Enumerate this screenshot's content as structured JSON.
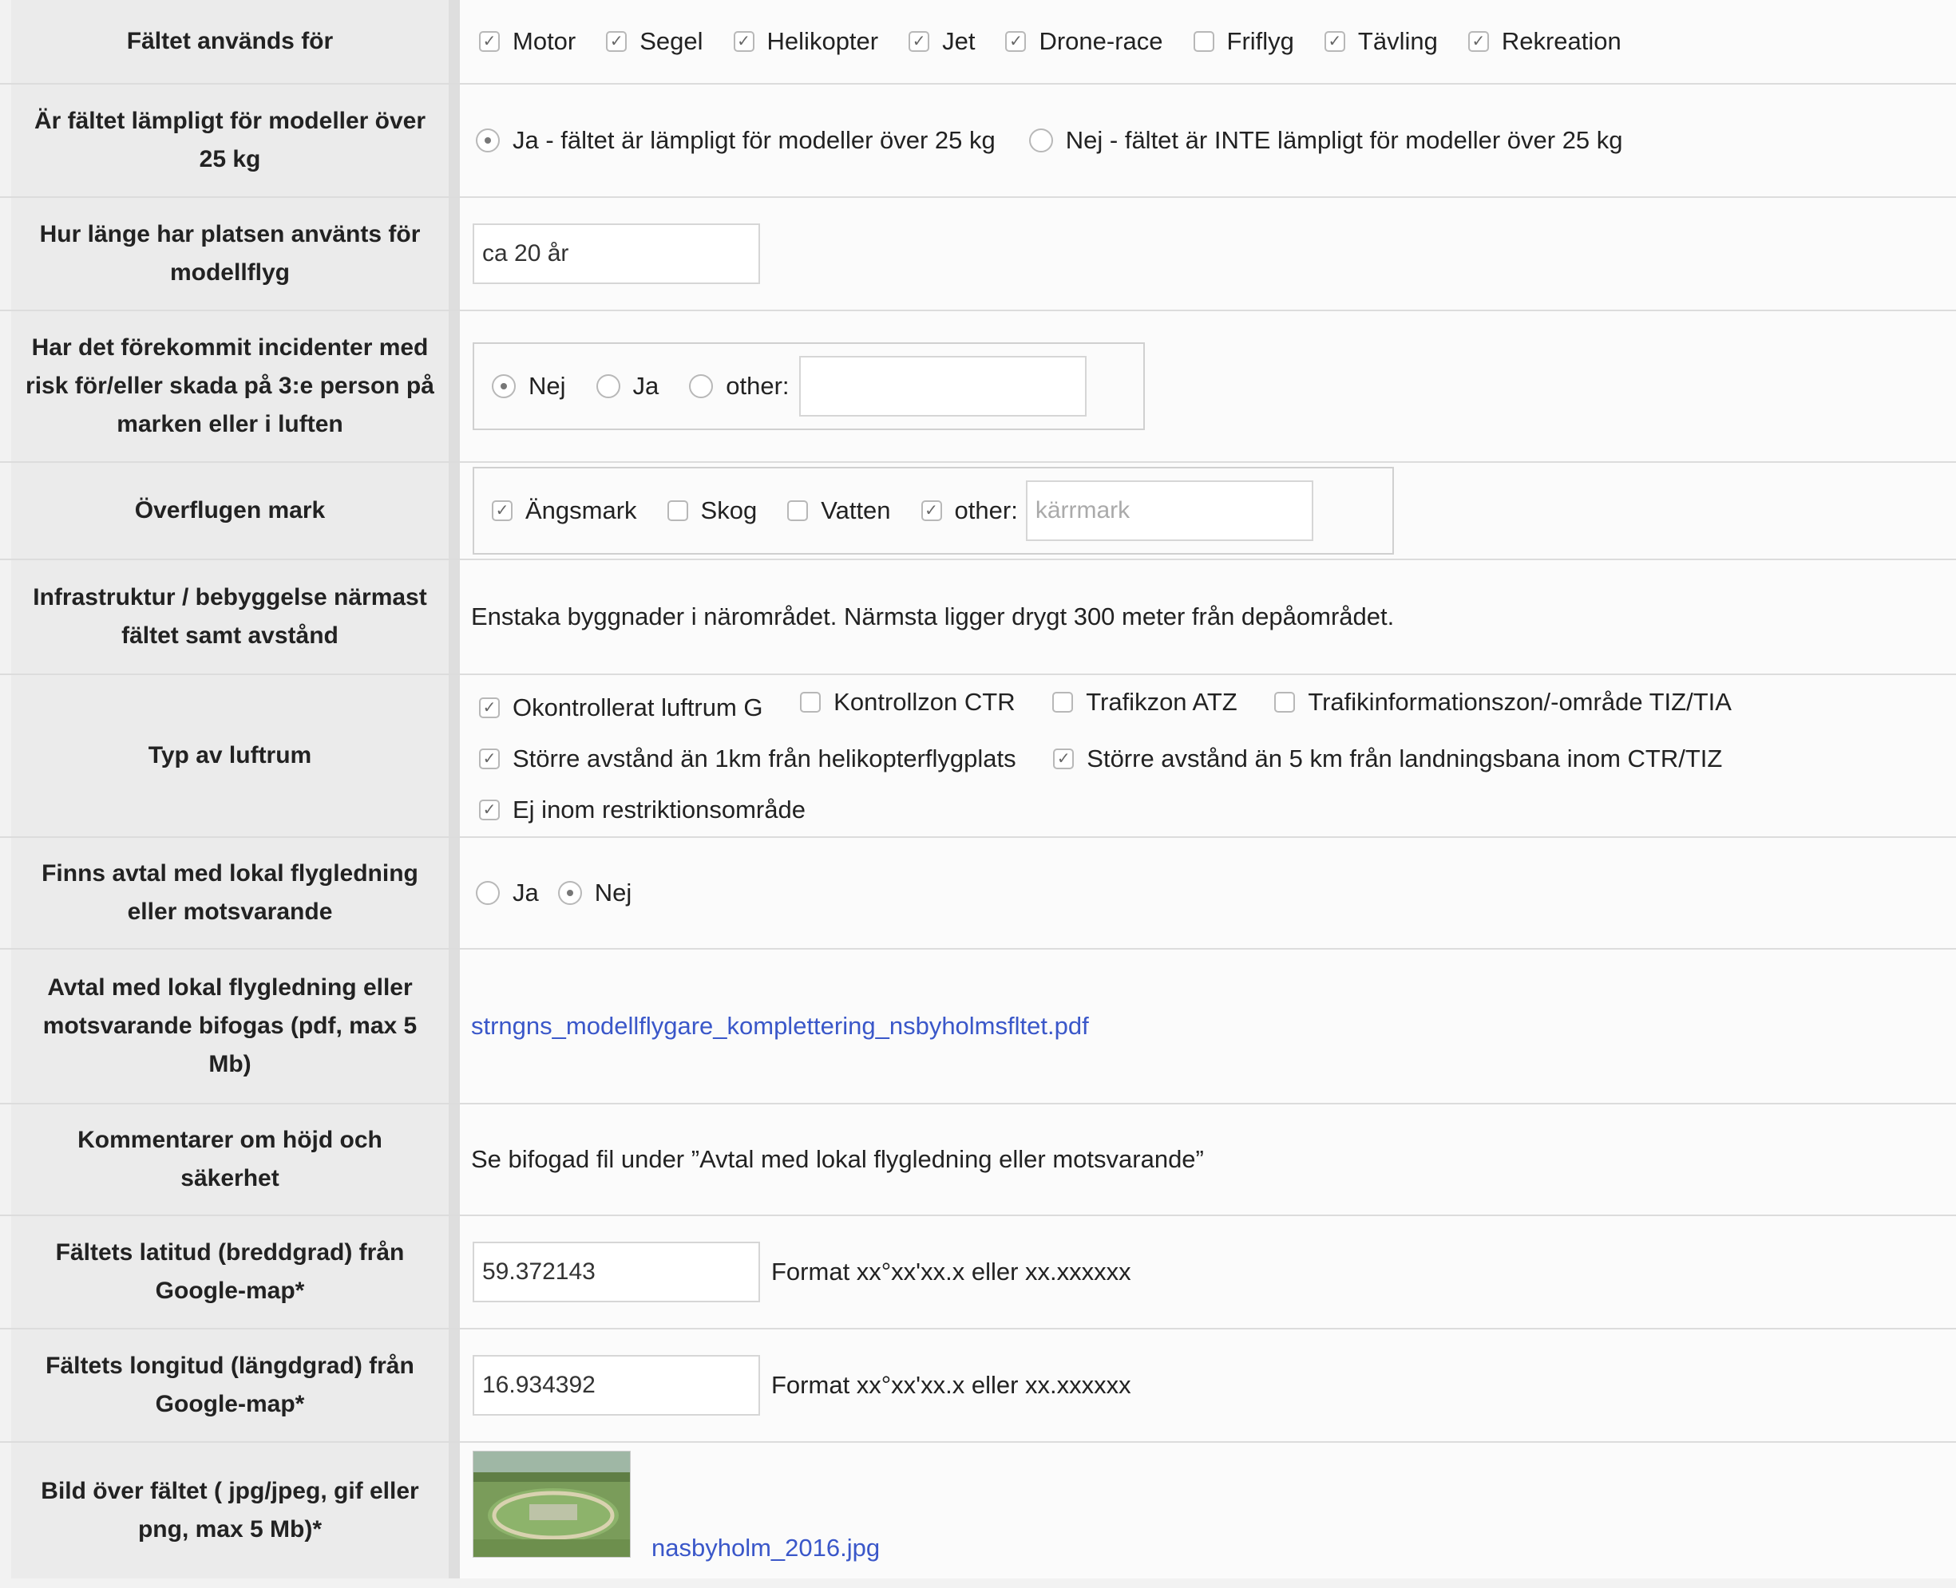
{
  "rows": {
    "usage": {
      "label": "Fältet används för",
      "options": [
        {
          "label": "Motor",
          "checked": true
        },
        {
          "label": "Segel",
          "checked": true
        },
        {
          "label": "Helikopter",
          "checked": true
        },
        {
          "label": "Jet",
          "checked": true
        },
        {
          "label": "Drone-race",
          "checked": true
        },
        {
          "label": "Friflyg",
          "checked": false
        },
        {
          "label": "Tävling",
          "checked": true
        },
        {
          "label": "Rekreation",
          "checked": true
        }
      ]
    },
    "over25": {
      "label": "Är fältet lämpligt för modeller över 25 kg",
      "options": [
        {
          "label": "Ja - fältet är lämpligt för modeller över 25 kg",
          "selected": true
        },
        {
          "label": "Nej - fältet är INTE lämpligt för modeller över 25 kg",
          "selected": false
        }
      ]
    },
    "duration": {
      "label": "Hur länge har platsen använts för modellflyg",
      "value": "ca 20 år"
    },
    "incidents": {
      "label": "Har det förekommit incidenter med risk för/eller skada på 3:e person på marken eller i luften",
      "options": [
        {
          "label": "Nej",
          "selected": true
        },
        {
          "label": "Ja",
          "selected": false
        },
        {
          "label": "other:",
          "selected": false
        }
      ],
      "other_value": ""
    },
    "ground": {
      "label": "Överflugen mark",
      "options": [
        {
          "label": "Ängsmark",
          "checked": true
        },
        {
          "label": "Skog",
          "checked": false
        },
        {
          "label": "Vatten",
          "checked": false
        },
        {
          "label": "other:",
          "checked": true
        }
      ],
      "other_placeholder": "kärrmark"
    },
    "infra": {
      "label": "Infrastruktur / bebyggelse närmast fältet samt avstånd",
      "value": "Enstaka byggnader i närområdet. Närmsta ligger drygt 300 meter från depåområdet."
    },
    "airspace": {
      "label": "Typ av luftrum",
      "line1": [
        {
          "label": "Okontrollerat luftrum G",
          "checked": true
        },
        {
          "label": "Kontrollzon CTR",
          "checked": false
        },
        {
          "label": "Trafikzon ATZ",
          "checked": false
        },
        {
          "label": "Trafikinformationszon/-område TIZ/TIA",
          "checked": false
        }
      ],
      "line2": [
        {
          "label": "Större avstånd än 1km från helikopterflygplats",
          "checked": true
        },
        {
          "label": "Större avstånd än 5 km från landningsbana inom CTR/TIZ",
          "checked": true
        }
      ],
      "line3": [
        {
          "label": "Ej inom restriktionsområde",
          "checked": true
        }
      ]
    },
    "agreement": {
      "label": "Finns avtal med lokal flygledning eller motsvarande",
      "options": [
        {
          "label": "Ja",
          "selected": false
        },
        {
          "label": "Nej",
          "selected": true
        }
      ]
    },
    "agreement_file": {
      "label": "Avtal med lokal flygledning eller motsvarande bifogas (pdf, max 5 Mb)",
      "link": "strngns_modellflygare_komplettering_nsbyholmsfltet.pdf"
    },
    "comments": {
      "label": "Kommentarer om höjd och säkerhet",
      "value": "Se bifogad fil under ”Avtal med lokal flygledning eller motsvarande”"
    },
    "latitude": {
      "label": "Fältets latitud (breddgrad) från Google-map*",
      "value": "59.372143",
      "hint": "Format xx°xx'xx.x eller xx.xxxxxx"
    },
    "longitude": {
      "label": "Fältets longitud (längdgrad) från Google-map*",
      "value": "16.934392",
      "hint": "Format xx°xx'xx.x eller xx.xxxxxx"
    },
    "image": {
      "label": "Bild över fältet ( jpg/jpeg, gif eller png, max 5 Mb)*",
      "link": "nasbyholm_2016.jpg"
    }
  }
}
